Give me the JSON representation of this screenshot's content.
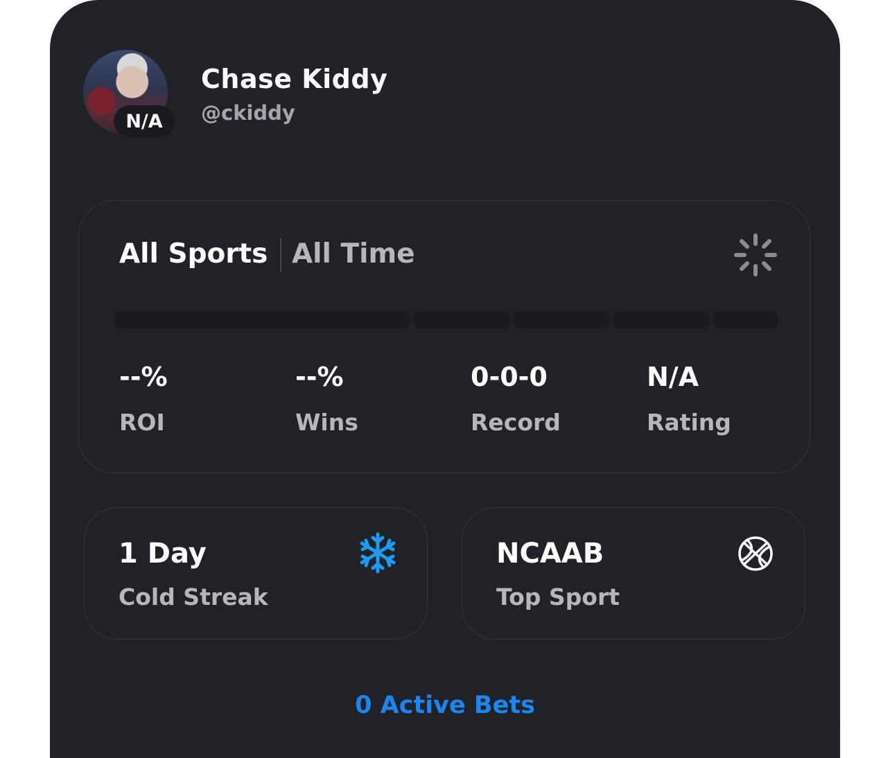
{
  "profile": {
    "name": "Chase Kiddy",
    "handle": "@ckiddy",
    "avatar_badge": "N/A"
  },
  "filters": {
    "sport": "All Sports",
    "time": "All Time"
  },
  "loading_icon": "spinner-icon",
  "stats": [
    {
      "value": "--%",
      "label": "ROI"
    },
    {
      "value": "--%",
      "label": "Wins"
    },
    {
      "value": "0-0-0",
      "label": "Record"
    },
    {
      "value": "N/A",
      "label": "Rating"
    }
  ],
  "streak": {
    "value": "1 Day",
    "label": "Cold Streak",
    "icon": "snowflake-icon",
    "icon_color": "#1e9bf0"
  },
  "top_sport": {
    "value": "NCAAB",
    "label": "Top Sport",
    "icon": "basketball-icon"
  },
  "active_bets": "0 Active Bets",
  "colors": {
    "card_bg": "#212228",
    "accent": "#1b86f0"
  }
}
